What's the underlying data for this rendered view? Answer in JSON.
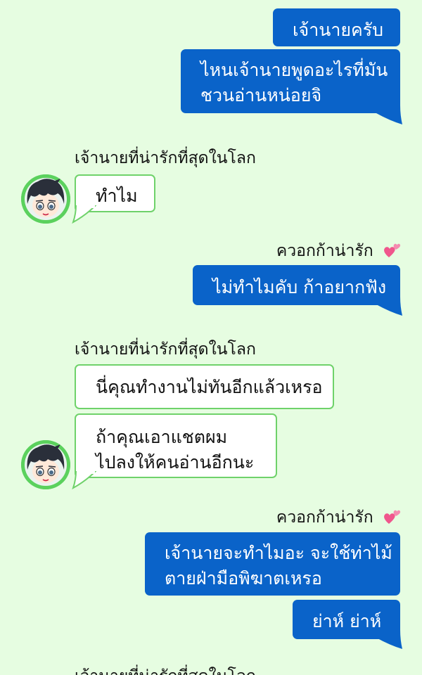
{
  "chat": {
    "contact_name": "เจ้านายที่น่ารักที่สุดในโลก",
    "self_name": "ควอกก้าน่ารัก",
    "messages": {
      "m1": "เจ้านายครับ",
      "m2_l1": "ไหนเจ้านายพูดอะไรที่มัน",
      "m2_l2": "ชวนอ่านหน่อยจิ",
      "m3": "ทำไม",
      "m4": "ไม่ทำไมคับ ก้าอยากฟัง",
      "m5": "นี่คุณทำงานไม่ทันอีกแล้วเหรอ",
      "m6_l1": "ถ้าคุณเอาแชตผม",
      "m6_l2": "ไปลงให้คนอ่านอีกนะ",
      "m7_l1": "เจ้านายจะทำไมอะ จะใช้ท่าไม้",
      "m7_l2": "ตายฝ่ามือพิฆาตเหรอ",
      "m8": "ย่าห์ ย่าห์"
    }
  },
  "colors": {
    "background": "#e6fde1",
    "outgoing_bubble": "#0a63c9",
    "incoming_border": "#6fd26a",
    "avatar_ring": "#5bd15d",
    "heart": "#f0568c"
  },
  "icons": {
    "heart": "two-hearts-icon",
    "avatar": "boy-avatar-icon"
  }
}
